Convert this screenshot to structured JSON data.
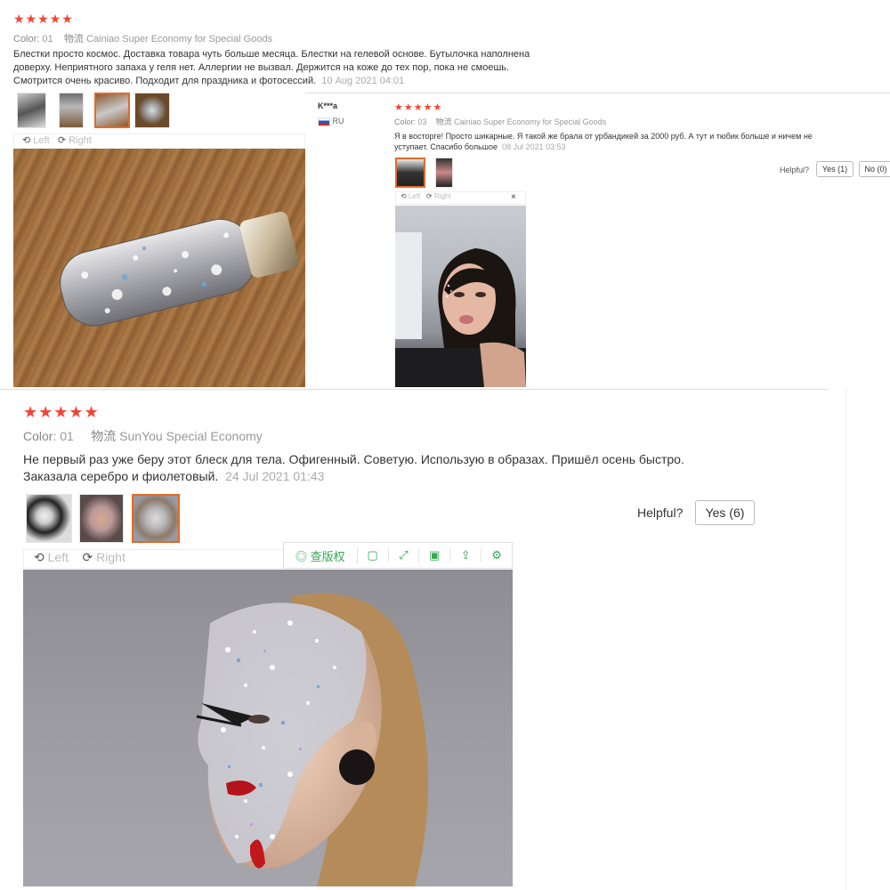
{
  "review1": {
    "stars": "★★★★★",
    "color_label": "Color:",
    "color_value": "01",
    "logistics_label": "物流",
    "logistics_value": "Cainiao Super Economy for Special Goods",
    "text_line1": "Блестки просто космос. Доставка товара чуть больше месяца. Блестки на гелевой основе. Бутылочка наполнена",
    "text_line2": "доверху. Неприятного запаха у геля нет. Аллергии не вызвал. Держится на коже до тех пор, пока не смоешь.",
    "text_line3": "Смотрится очень красиво. Подходит для праздника и фотосессий.",
    "date": "10 Aug 2021 04:01",
    "left_label": "Left",
    "right_label": "Right"
  },
  "review2": {
    "user": "K***a",
    "country": "RU",
    "stars": "★★★★★",
    "color_label": "Color:",
    "color_value": "03",
    "logistics_label": "物流",
    "logistics_value": "Cainiao Super Economy for Special Goods",
    "text_line1": "Я в восторге! Просто шикарные. Я такой же брала от урбандикей за 2000 руб. А тут и тюбик больше и ничем не",
    "text_line2": "уступает. Спасибо большое",
    "date": "08 Jul 2021 03:53",
    "helpful_label": "Helpful?",
    "yes_label": "Yes (1)",
    "no_label": "No (0)",
    "left_label": "Left",
    "right_label": "Right",
    "close": "×"
  },
  "review3": {
    "stars": "★★★★★",
    "color_label": "Color:",
    "color_value": "01",
    "logistics_label": "物流",
    "logistics_value": "SunYou Special Economy",
    "text_line1": "Не первый раз уже беру этот блеск для тела. Офигенный. Советую. Использую в образах. Пришёл осень быстро.",
    "text_line2": "Заказала серебро и фиолетовый.",
    "date": "24 Jul 2021 01:43",
    "helpful_label": "Helpful?",
    "yes_label": "Yes (6)",
    "left_label": "Left",
    "right_label": "Right",
    "toolbar_copyright": "查版权"
  },
  "colors": {
    "star": "#f44336",
    "selected_border": "#e06b2a",
    "toolbar_green": "#34a853"
  }
}
